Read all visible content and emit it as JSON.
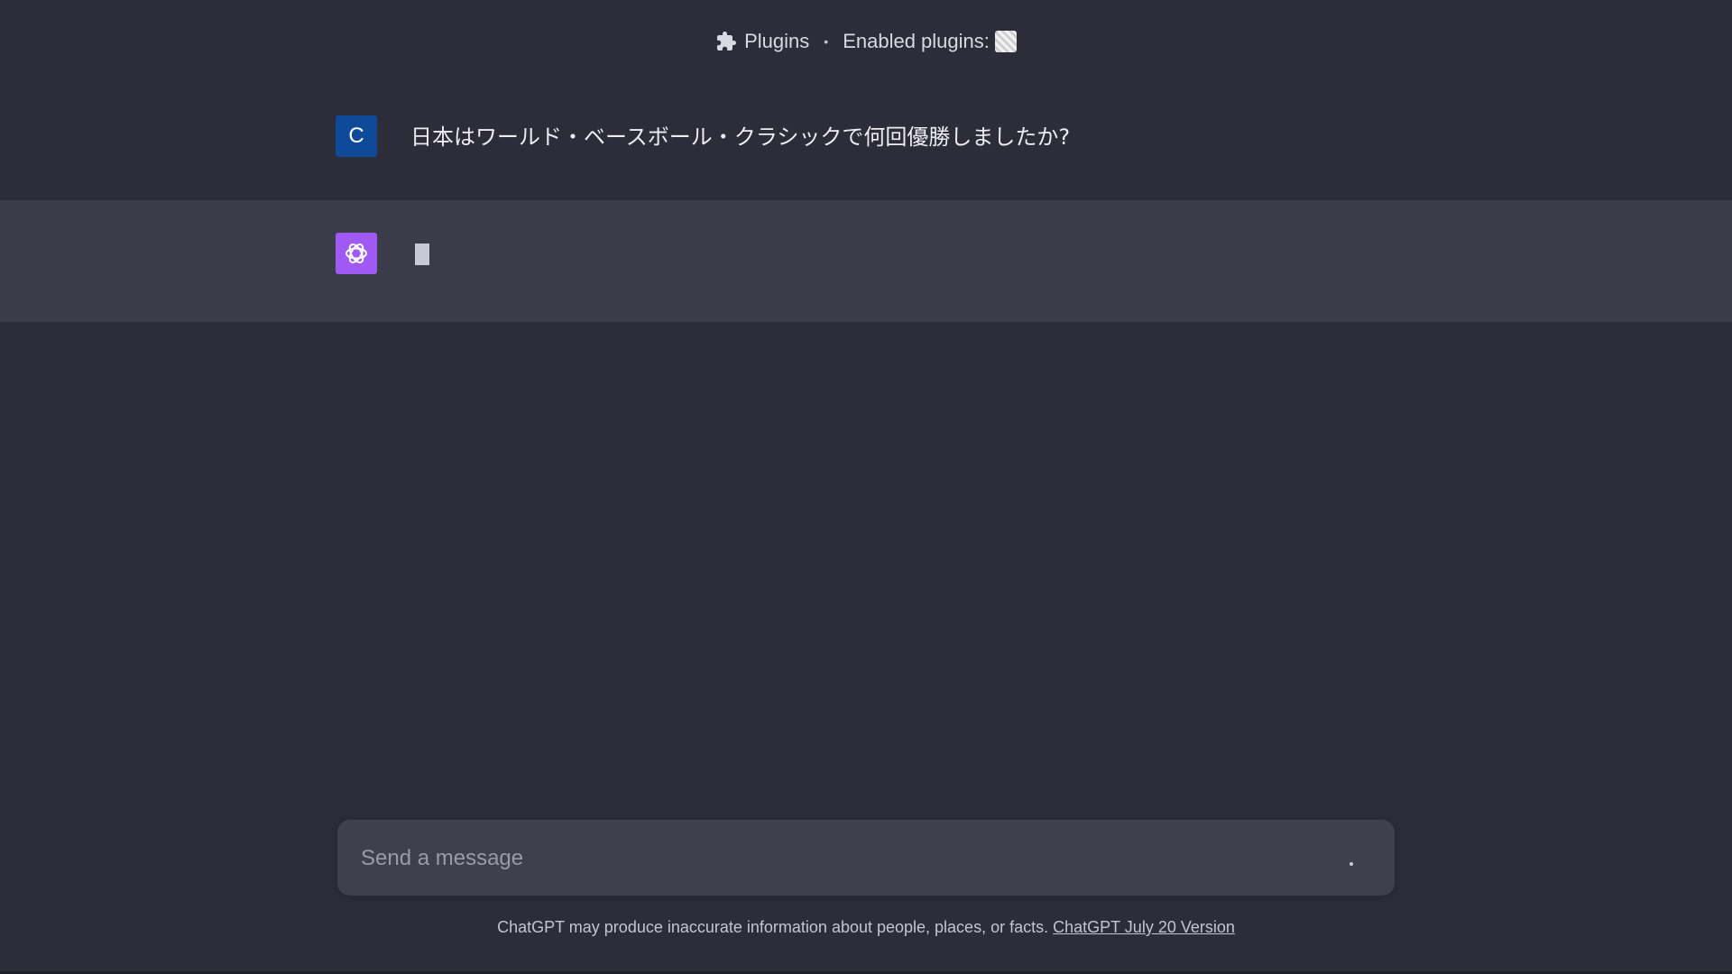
{
  "header": {
    "plugins_label": "Plugins",
    "separator": "•",
    "enabled_label": "Enabled plugins:"
  },
  "conversation": {
    "user_avatar_letter": "C",
    "user_message": "日本はワールド・ベースボール・クラシックで何回優勝しましたか?"
  },
  "composer": {
    "placeholder": "Send a message"
  },
  "footer": {
    "disclaimer": "ChatGPT may produce inaccurate information about people, places, or facts.",
    "version_link": "ChatGPT July 20 Version"
  },
  "colors": {
    "background": "#2c2d39",
    "assistant_row": "#3b3c4a",
    "user_avatar": "#0f4a9a",
    "gpt_avatar": "#a05af3"
  }
}
